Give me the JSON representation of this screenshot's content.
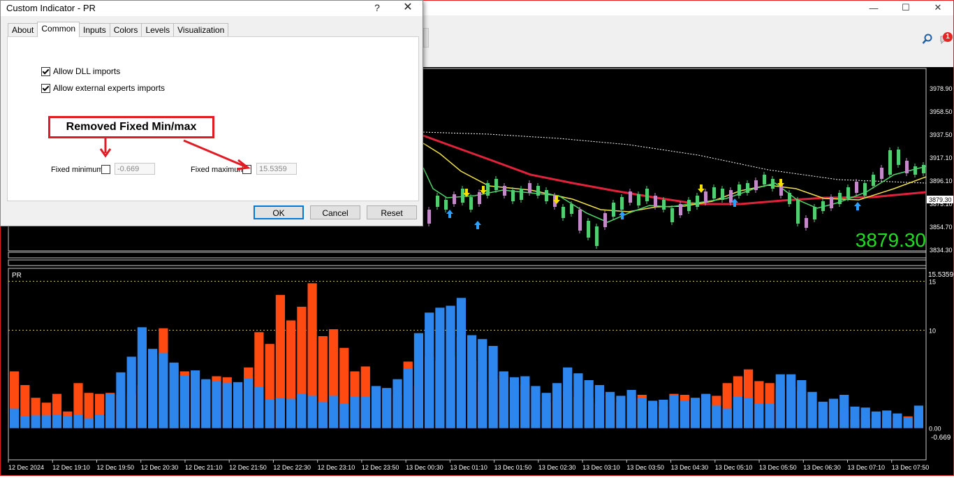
{
  "window": {
    "controls": [
      "—",
      "☐",
      "✕"
    ],
    "notification_count": "1"
  },
  "dialog": {
    "title": "Custom Indicator - PR",
    "help_label": "?",
    "close_label": "✕",
    "tabs": [
      {
        "label": "About"
      },
      {
        "label": "Common",
        "active": true
      },
      {
        "label": "Inputs"
      },
      {
        "label": "Colors"
      },
      {
        "label": "Levels"
      },
      {
        "label": "Visualization"
      }
    ],
    "allow_dll": {
      "label": "Allow DLL imports",
      "checked": true
    },
    "allow_experts": {
      "label": "Allow external experts imports",
      "checked": true
    },
    "fixed_min": {
      "label": "Fixed minimum",
      "checked": false,
      "value": "-0.669"
    },
    "fixed_max": {
      "label": "Fixed maximum",
      "checked": false,
      "value": "15.5359"
    },
    "buttons": {
      "ok": "OK",
      "cancel": "Cancel",
      "reset": "Reset"
    }
  },
  "annotation": {
    "text": "Removed Fixed Min/max",
    "color": "#e01b24"
  },
  "price_chart": {
    "price_axis": [
      "3978.90",
      "3958.50",
      "3937.50",
      "3917.10",
      "3896.10",
      "3875.10",
      "3854.70",
      "3834.30"
    ],
    "current_price_tag": "3879.30",
    "big_price": "3879.30",
    "big_price_color": "#22dd22"
  },
  "indicator": {
    "name": "PR",
    "top_left_label": "15.5359",
    "axis": [
      "15",
      "10",
      "0.00"
    ],
    "bottom_right_label": "-0.669",
    "colors": {
      "rising": "#ff4a12",
      "falling": "#2d86ee"
    }
  },
  "time_axis": [
    "12 Dec 2024",
    "12 Dec 19:10",
    "12 Dec 19:50",
    "12 Dec 20:30",
    "12 Dec 21:10",
    "12 Dec 21:50",
    "12 Dec 22:30",
    "12 Dec 23:10",
    "12 Dec 23:50",
    "13 Dec 00:30",
    "13 Dec 01:10",
    "13 Dec 01:50",
    "13 Dec 02:30",
    "13 Dec 03:10",
    "13 Dec 03:50",
    "13 Dec 04:30",
    "13 Dec 05:10",
    "13 Dec 05:50",
    "13 Dec 06:30",
    "13 Dec 07:10",
    "13 Dec 07:50"
  ],
  "chart_data": {
    "type": "bar",
    "title": "PR",
    "xlabel": "",
    "ylabel": "",
    "ylim": [
      -0.669,
      15.5359
    ],
    "levels": [
      10,
      15
    ],
    "series": [
      {
        "color": "#ff4a12",
        "values": [
          5.8,
          4.4,
          3.1,
          2.6,
          3.5,
          1.7,
          4.6,
          3.6,
          3.5,
          3.6,
          3.4,
          3.5,
          4.4,
          7.5,
          10.2,
          6.4,
          5.8,
          3.9,
          4.9,
          5.3,
          5.2,
          4.1,
          6.2,
          9.8,
          8.6,
          13.6,
          11.0,
          12.4,
          14.8,
          9.4,
          10.1,
          8.2,
          5.8,
          6.3,
          4.2,
          4.0,
          3.4,
          6.8,
          4.3,
          7.3,
          6.9,
          7.3,
          9.3,
          6.9,
          4.8,
          5.0,
          5.4,
          4.6,
          4.4,
          4.1,
          2.6,
          2.8,
          3.8,
          3.2,
          3.1,
          2.5,
          3.1,
          2.6,
          3.1,
          3.4,
          2.4,
          2.2,
          3.5,
          3.4,
          2.8,
          3.4,
          3.3,
          4.6,
          5.3,
          6.0,
          4.8,
          4.6,
          4.1,
          4.2,
          3.8,
          3.6,
          2.6,
          2.8,
          1.8,
          0.9,
          1.0,
          1.0,
          1.2,
          1.0,
          1.2,
          1.6
        ]
      },
      {
        "color": "#2d86ee",
        "values": [
          2.0,
          1.2,
          1.3,
          1.3,
          1.4,
          1.2,
          1.4,
          1.0,
          1.4,
          3.5,
          5.7,
          7.3,
          10.3,
          8.1,
          7.7,
          6.7,
          5.4,
          5.9,
          5.0,
          4.8,
          4.6,
          4.7,
          5.1,
          4.2,
          2.9,
          3.1,
          3.0,
          3.5,
          3.3,
          2.7,
          3.3,
          2.5,
          3.2,
          3.2,
          4.3,
          4.1,
          5.0,
          6.1,
          9.7,
          11.8,
          12.3,
          12.5,
          13.3,
          9.5,
          9.1,
          8.4,
          5.8,
          5.2,
          5.3,
          4.3,
          3.6,
          4.6,
          6.2,
          5.6,
          4.9,
          4.4,
          3.7,
          3.3,
          3.9,
          3.1,
          2.8,
          2.9,
          3.4,
          2.8,
          3.1,
          3.5,
          2.3,
          2.0,
          3.2,
          3.1,
          2.5,
          2.5,
          5.5,
          5.5,
          4.9,
          3.7,
          2.7,
          3.0,
          3.4,
          2.2,
          2.1,
          1.7,
          1.8,
          1.5,
          1.1,
          2.3
        ]
      }
    ]
  }
}
